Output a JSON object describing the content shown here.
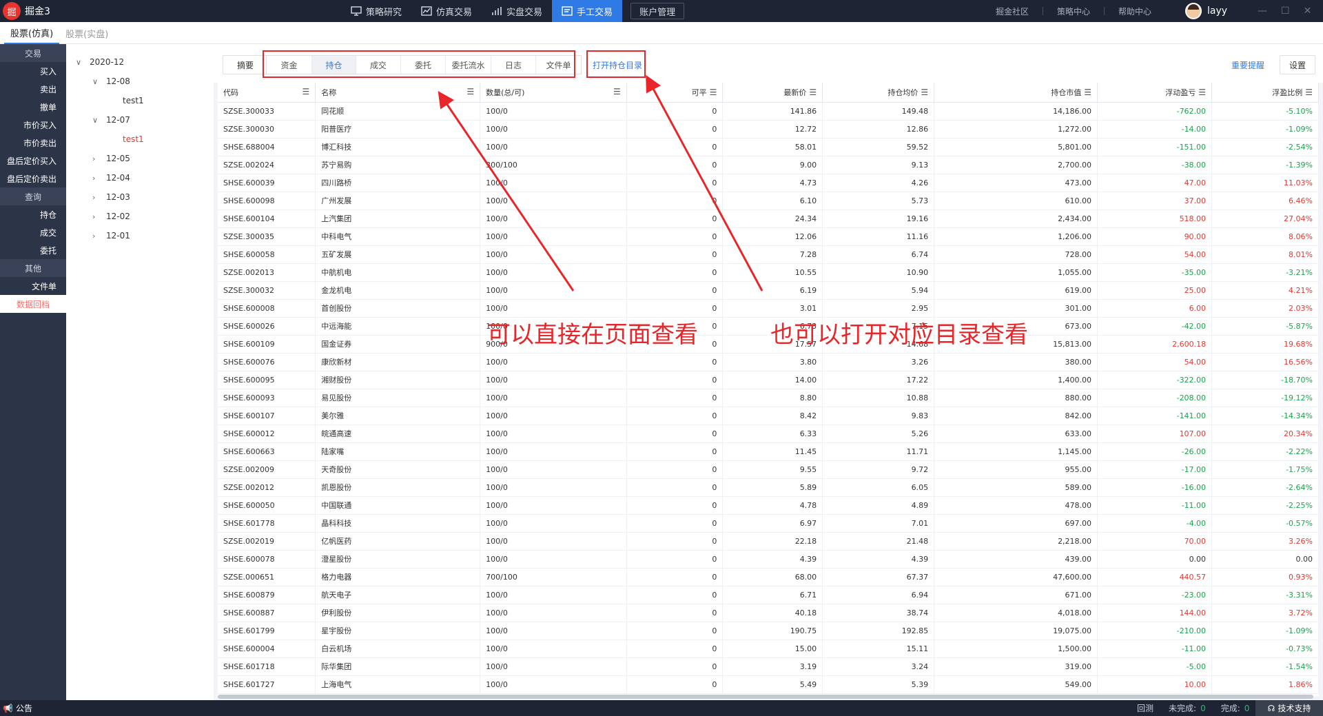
{
  "app": {
    "logo_char": "掘",
    "title": "掘金3"
  },
  "nav": [
    {
      "label": "策略研究",
      "icon": "monitor-icon"
    },
    {
      "label": "仿真交易",
      "icon": "chart-icon"
    },
    {
      "label": "实盘交易",
      "icon": "bars-icon"
    },
    {
      "label": "手工交易",
      "icon": "trade-icon",
      "active": true
    }
  ],
  "account_button": "账户管理",
  "right_links": [
    "掘金社区",
    "策略中心",
    "帮助中心"
  ],
  "user": {
    "name": "layy"
  },
  "window_controls": [
    "—",
    "☐",
    "✕"
  ],
  "subtabs": [
    {
      "label": "股票(仿真)",
      "active": true
    },
    {
      "label": "股票(实盘)"
    }
  ],
  "sidebar": {
    "sections": [
      {
        "title": "交易",
        "items": [
          "买入",
          "卖出",
          "撤单",
          "市价买入",
          "市价卖出",
          "盘后定价买入",
          "盘后定价卖出"
        ]
      },
      {
        "title": "查询",
        "items": [
          "持仓",
          "成交",
          "委托"
        ]
      },
      {
        "title": "其他",
        "items": [
          "文件单"
        ]
      }
    ],
    "highlight_item": "数据回档"
  },
  "tree": {
    "root": "2020-12",
    "nodes": [
      {
        "label": "12-08",
        "expanded": true,
        "children": [
          {
            "label": "test1",
            "active": false
          }
        ]
      },
      {
        "label": "12-07",
        "expanded": true,
        "children": [
          {
            "label": "test1",
            "active": true
          }
        ]
      },
      {
        "label": "12-05"
      },
      {
        "label": "12-04"
      },
      {
        "label": "12-03"
      },
      {
        "label": "12-02"
      },
      {
        "label": "12-01"
      }
    ]
  },
  "toolbar": {
    "summary": "摘要",
    "tabs": [
      "资金",
      "持仓",
      "成交",
      "委托",
      "委托流水",
      "日志",
      "文件单"
    ],
    "active_tab": "持仓",
    "open_dir": "打开持仓目录",
    "remind": "重要提醒",
    "settings": "设置"
  },
  "table": {
    "columns": [
      "代码",
      "名称",
      "数量(总/可)",
      "可平",
      "最新价",
      "持仓均价",
      "持仓市值",
      "浮动盈亏",
      "浮盈比例"
    ],
    "rows": [
      [
        "SZSE.300033",
        "同花顺",
        "100/0",
        "0",
        "141.86",
        "149.48",
        "14,186.00",
        "-762.00",
        "-5.10%"
      ],
      [
        "SZSE.300030",
        "阳普医疗",
        "100/0",
        "0",
        "12.72",
        "12.86",
        "1,272.00",
        "-14.00",
        "-1.09%"
      ],
      [
        "SHSE.688004",
        "博汇科技",
        "100/0",
        "0",
        "58.01",
        "59.52",
        "5,801.00",
        "-151.00",
        "-2.54%"
      ],
      [
        "SZSE.002024",
        "苏宁易购",
        "300/100",
        "0",
        "9.00",
        "9.13",
        "2,700.00",
        "-38.00",
        "-1.39%"
      ],
      [
        "SHSE.600039",
        "四川路桥",
        "100/0",
        "0",
        "4.73",
        "4.26",
        "473.00",
        "47.00",
        "11.03%"
      ],
      [
        "SHSE.600098",
        "广州发展",
        "100/0",
        "0",
        "6.10",
        "5.73",
        "610.00",
        "37.00",
        "6.46%"
      ],
      [
        "SHSE.600104",
        "上汽集团",
        "100/0",
        "0",
        "24.34",
        "19.16",
        "2,434.00",
        "518.00",
        "27.04%"
      ],
      [
        "SZSE.300035",
        "中科电气",
        "100/0",
        "0",
        "12.06",
        "11.16",
        "1,206.00",
        "90.00",
        "8.06%"
      ],
      [
        "SHSE.600058",
        "五矿发展",
        "100/0",
        "0",
        "7.28",
        "6.74",
        "728.00",
        "54.00",
        "8.01%"
      ],
      [
        "SZSE.002013",
        "中航机电",
        "100/0",
        "0",
        "10.55",
        "10.90",
        "1,055.00",
        "-35.00",
        "-3.21%"
      ],
      [
        "SZSE.300032",
        "金龙机电",
        "100/0",
        "0",
        "6.19",
        "5.94",
        "619.00",
        "25.00",
        "4.21%"
      ],
      [
        "SHSE.600008",
        "首创股份",
        "100/0",
        "0",
        "3.01",
        "2.95",
        "301.00",
        "6.00",
        "2.03%"
      ],
      [
        "SHSE.600026",
        "中远海能",
        "100/0",
        "0",
        "6.73",
        "7.15",
        "673.00",
        "-42.00",
        "-5.87%"
      ],
      [
        "SHSE.600109",
        "国金证券",
        "900/0",
        "0",
        "17.57",
        "14.68",
        "15,813.00",
        "2,600.18",
        "19.68%"
      ],
      [
        "SHSE.600076",
        "康欣新材",
        "100/0",
        "0",
        "3.80",
        "3.26",
        "380.00",
        "54.00",
        "16.56%"
      ],
      [
        "SHSE.600095",
        "湘财股份",
        "100/0",
        "0",
        "14.00",
        "17.22",
        "1,400.00",
        "-322.00",
        "-18.70%"
      ],
      [
        "SHSE.600093",
        "易见股份",
        "100/0",
        "0",
        "8.80",
        "10.88",
        "880.00",
        "-208.00",
        "-19.12%"
      ],
      [
        "SHSE.600107",
        "美尔雅",
        "100/0",
        "0",
        "8.42",
        "9.83",
        "842.00",
        "-141.00",
        "-14.34%"
      ],
      [
        "SHSE.600012",
        "皖通高速",
        "100/0",
        "0",
        "6.33",
        "5.26",
        "633.00",
        "107.00",
        "20.34%"
      ],
      [
        "SHSE.600663",
        "陆家嘴",
        "100/0",
        "0",
        "11.45",
        "11.71",
        "1,145.00",
        "-26.00",
        "-2.22%"
      ],
      [
        "SZSE.002009",
        "天奇股份",
        "100/0",
        "0",
        "9.55",
        "9.72",
        "955.00",
        "-17.00",
        "-1.75%"
      ],
      [
        "SZSE.002012",
        "凯恩股份",
        "100/0",
        "0",
        "5.89",
        "6.05",
        "589.00",
        "-16.00",
        "-2.64%"
      ],
      [
        "SHSE.600050",
        "中国联通",
        "100/0",
        "0",
        "4.78",
        "4.89",
        "478.00",
        "-11.00",
        "-2.25%"
      ],
      [
        "SHSE.601778",
        "晶科科技",
        "100/0",
        "0",
        "6.97",
        "7.01",
        "697.00",
        "-4.00",
        "-0.57%"
      ],
      [
        "SZSE.002019",
        "亿帆医药",
        "100/0",
        "0",
        "22.18",
        "21.48",
        "2,218.00",
        "70.00",
        "3.26%"
      ],
      [
        "SHSE.600078",
        "澄星股份",
        "100/0",
        "0",
        "4.39",
        "4.39",
        "439.00",
        "0.00",
        "0.00"
      ],
      [
        "SZSE.000651",
        "格力电器",
        "700/100",
        "0",
        "68.00",
        "67.37",
        "47,600.00",
        "440.57",
        "0.93%"
      ],
      [
        "SHSE.600879",
        "航天电子",
        "100/0",
        "0",
        "6.71",
        "6.94",
        "671.00",
        "-23.00",
        "-3.31%"
      ],
      [
        "SHSE.600887",
        "伊利股份",
        "100/0",
        "0",
        "40.18",
        "38.74",
        "4,018.00",
        "144.00",
        "3.72%"
      ],
      [
        "SHSE.601799",
        "星宇股份",
        "100/0",
        "0",
        "190.75",
        "192.85",
        "19,075.00",
        "-210.00",
        "-1.09%"
      ],
      [
        "SHSE.600004",
        "白云机场",
        "100/0",
        "0",
        "15.00",
        "15.11",
        "1,500.00",
        "-11.00",
        "-0.73%"
      ],
      [
        "SHSE.601718",
        "际华集团",
        "100/0",
        "0",
        "3.19",
        "3.24",
        "319.00",
        "-5.00",
        "-1.54%"
      ],
      [
        "SHSE.601727",
        "上海电气",
        "100/0",
        "0",
        "5.49",
        "5.39",
        "549.00",
        "10.00",
        "1.86%"
      ]
    ]
  },
  "annotations": {
    "left": "可以直接在页面查看",
    "right": "也可以打开对应目录查看"
  },
  "statusbar": {
    "notice": "公告",
    "rollback": "回测",
    "unfinished_label": "未完成:",
    "unfinished": "0",
    "done_label": "完成:",
    "done": "0",
    "support": "技术支持"
  },
  "colors": {
    "up": "#e8362f",
    "down": "#19a34a",
    "accent": "#2f7ae5",
    "annotation": "#e8262a"
  }
}
